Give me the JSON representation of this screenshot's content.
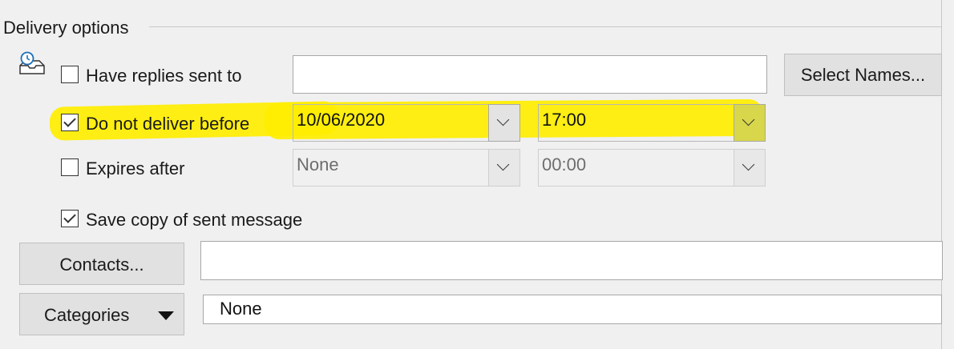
{
  "group": {
    "title": "Delivery options"
  },
  "icons": {
    "delay": "delay-delivery-icon"
  },
  "replies": {
    "label": "Have replies sent to",
    "checked": false,
    "value": "",
    "select_names_label": "Select Names..."
  },
  "deliver_before": {
    "label": "Do not deliver before",
    "checked": true,
    "date": "10/06/2020",
    "time": "17:00"
  },
  "expires": {
    "label": "Expires after",
    "checked": false,
    "date": "None",
    "time": "00:00"
  },
  "save_copy": {
    "label": "Save copy of sent message",
    "checked": true
  },
  "contacts": {
    "button_label": "Contacts...",
    "value": ""
  },
  "categories": {
    "button_label": "Categories",
    "value": "None"
  },
  "colors": {
    "highlight": "#ffee00",
    "background": "#f0f0f0"
  }
}
